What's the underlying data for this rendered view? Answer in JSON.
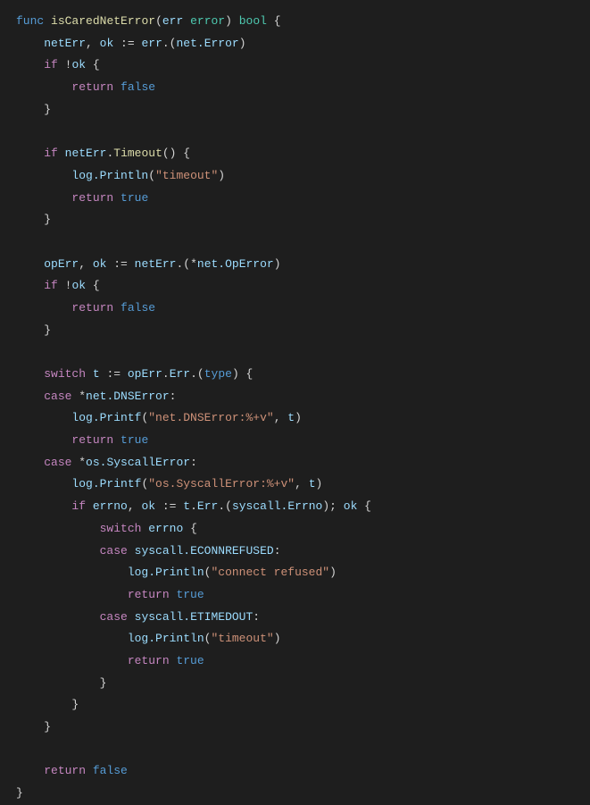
{
  "code": {
    "lang": "go",
    "function_name": "isCaredNetError",
    "param_name": "err",
    "param_type": "error",
    "return_type": "bool",
    "strings": {
      "timeout": "\"timeout\"",
      "dns_error": "\"net.DNSError:%+v\"",
      "syscall_error": "\"os.SyscallError:%+v\"",
      "connect_refused": "\"connect refused\"",
      "timeout2": "\"timeout\""
    },
    "keywords": {
      "func": "func",
      "if": "if",
      "return": "return",
      "switch": "switch",
      "case": "case",
      "type": "type",
      "false": "false",
      "true": "true"
    },
    "identifiers": {
      "netErr": "netErr",
      "ok": "ok",
      "err": "err",
      "net_Error": "net.Error",
      "Timeout": "Timeout",
      "log_Println": "log.Println",
      "log_Printf": "log.Printf",
      "opErr": "opErr",
      "net_OpError": "net.OpError",
      "t": "t",
      "Err": "Err",
      "net_DNSError": "net.DNSError",
      "os_SyscallError": "os.SyscallError",
      "errno": "errno",
      "syscall_Errno": "syscall.Errno",
      "syscall_ECONNREFUSED": "syscall.ECONNREFUSED",
      "syscall_ETIMEDOUT": "syscall.ETIMEDOUT"
    }
  }
}
